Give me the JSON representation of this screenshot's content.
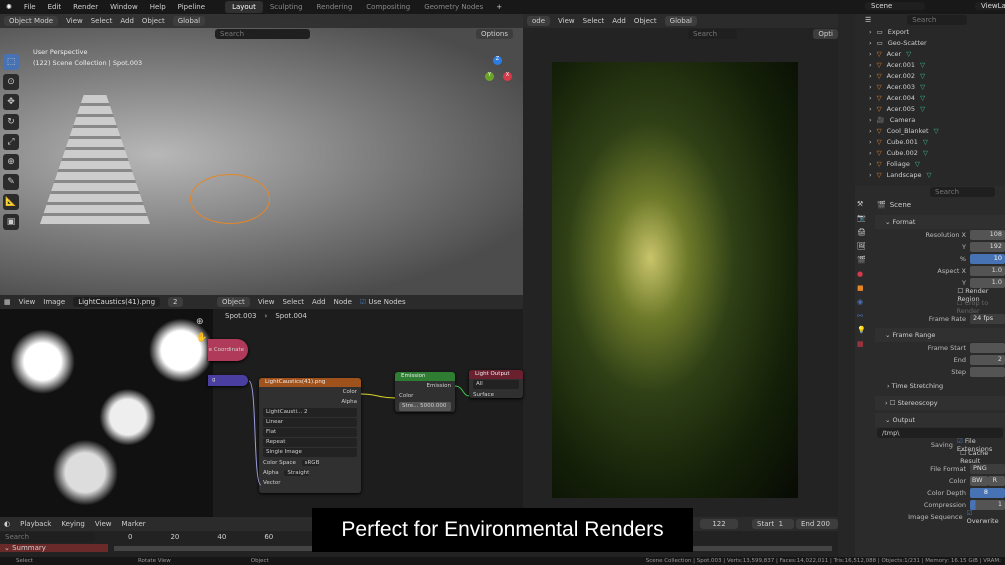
{
  "topbar": {
    "logo": "blender-logo",
    "menus": [
      "File",
      "Edit",
      "Render",
      "Window",
      "Help",
      "Pipeline"
    ],
    "workspaces": [
      "Layout",
      "Sculpting",
      "Rendering",
      "Compositing",
      "Geometry Nodes"
    ],
    "active_workspace": "Layout",
    "add_workspace": "+",
    "scene": "Scene",
    "view_layer": "ViewLayer"
  },
  "viewport": {
    "mode": "Object Mode",
    "menus": [
      "View",
      "Select",
      "Add",
      "Object"
    ],
    "orientation": "Global",
    "search_placeholder": "Search",
    "options": "Options",
    "perspective": "User Perspective",
    "collection_info": "(122) Scene Collection | Spot.003",
    "gizmo": {
      "z": "Z",
      "y": "Y",
      "x": "X"
    }
  },
  "viewport2": {
    "mode": "ode",
    "menus": [
      "View",
      "Select",
      "Add",
      "Object"
    ],
    "orientation": "Global",
    "search_placeholder": "Search",
    "options": "Opti"
  },
  "outliner": {
    "search_placeholder": "Search",
    "items": [
      {
        "name": "Export",
        "type": "collection"
      },
      {
        "name": "Geo-Scatter",
        "type": "collection"
      },
      {
        "name": "Acer",
        "type": "mesh"
      },
      {
        "name": "Acer.001",
        "type": "mesh"
      },
      {
        "name": "Acer.002",
        "type": "mesh"
      },
      {
        "name": "Acer.003",
        "type": "mesh"
      },
      {
        "name": "Acer.004",
        "type": "mesh"
      },
      {
        "name": "Acer.005",
        "type": "mesh"
      },
      {
        "name": "Camera",
        "type": "camera"
      },
      {
        "name": "Cool_Blanket",
        "type": "mesh"
      },
      {
        "name": "Cube.001",
        "type": "mesh"
      },
      {
        "name": "Cube.002",
        "type": "mesh"
      },
      {
        "name": "Foliage",
        "type": "mesh"
      },
      {
        "name": "Landscape",
        "type": "mesh"
      }
    ]
  },
  "properties": {
    "search_placeholder": "Search",
    "context": "Scene",
    "format": {
      "title": "Format",
      "resolution_x_label": "Resolution X",
      "resolution_x": "108",
      "y_label": "Y",
      "resolution_y": "192",
      "pct_label": "%",
      "pct": "10",
      "aspect_x_label": "Aspect X",
      "aspect_x": "1.0",
      "aspect_y_label": "Y",
      "aspect_y": "1.0",
      "render_region": "Render Region",
      "crop": "Crop to Render",
      "frame_rate_label": "Frame Rate",
      "frame_rate": "24 fps"
    },
    "frame_range": {
      "title": "Frame Range",
      "start_label": "Frame Start",
      "start": "",
      "end_label": "End",
      "end": "2",
      "step_label": "Step",
      "step": "",
      "time_stretching": "Time Stretching"
    },
    "stereoscopy": "Stereoscopy",
    "output": {
      "title": "Output",
      "path": "/tmp\\",
      "saving_label": "Saving",
      "file_ext": "File Extensions",
      "cache": "Cache Result",
      "file_format_label": "File Format",
      "file_format": "PNG",
      "color_label": "Color",
      "color_bw": "BW",
      "color_rg": "R",
      "depth_label": "Color Depth",
      "depth": "8",
      "compression_label": "Compression",
      "compression": "1",
      "compression_fraction": 0.15,
      "image_seq_label": "Image Sequence",
      "overwrite": "Overwrite"
    }
  },
  "image_editor": {
    "menus": [
      "View",
      "Image"
    ],
    "image": "LightCaustics(41).png",
    "users": "2"
  },
  "node_editor": {
    "type": "Object",
    "menus": [
      "View",
      "Select",
      "Add",
      "Node"
    ],
    "use_nodes": "Use Nodes",
    "breadcrumb": [
      "Spot.003",
      "Spot.004"
    ],
    "nodes": {
      "texcoord": "e Coordinate",
      "mapping": "g",
      "image": {
        "title": "LightCaustics(41).png",
        "out_color": "Color",
        "out_alpha": "Alpha",
        "img": "LightCausti...",
        "users": "2",
        "interp": "Linear",
        "proj": "Flat",
        "ext": "Repeat",
        "source": "Single Image",
        "cs_label": "Color Space",
        "cs": "sRGB",
        "alpha_label": "Alpha",
        "alpha": "Straight",
        "vector": "Vector"
      },
      "emission": {
        "title": "Emission",
        "out": "Emission",
        "color": "Color",
        "strength_label": "Stre...",
        "strength": "5000.000"
      },
      "output": {
        "title": "Light Output",
        "target": "All",
        "surface": "Surface"
      }
    }
  },
  "timeline": {
    "menus": [
      "Playback",
      "Keying",
      "View",
      "Marker"
    ],
    "search_placeholder": "Search",
    "summary": "Summary",
    "ticks": [
      "0",
      "20",
      "40",
      "60"
    ],
    "current_frame": "122",
    "start_label": "Start",
    "start": "1",
    "end_label": "End",
    "end": "200"
  },
  "caption": "Perfect for Environmental Renders",
  "status": {
    "select": "Select",
    "rotate": "Rotate View",
    "object": "Object",
    "stats": "Scene Collection | Spot.003 | Verts:13,599,837 | Faces:14,022,011 | Tris:16,512,088 | Objects:1/231 | Memory: 16.15 GiB | VRAM:"
  },
  "colors": {
    "accent": "#4772b3",
    "mesh": "#e4862a",
    "modifier": "#3cc48a",
    "emission_header": "#2e7d32",
    "image_header": "#a0521c",
    "output_header": "#6b2030",
    "texcoord": "#b03a5a",
    "mapping": "#4a3fa0"
  }
}
